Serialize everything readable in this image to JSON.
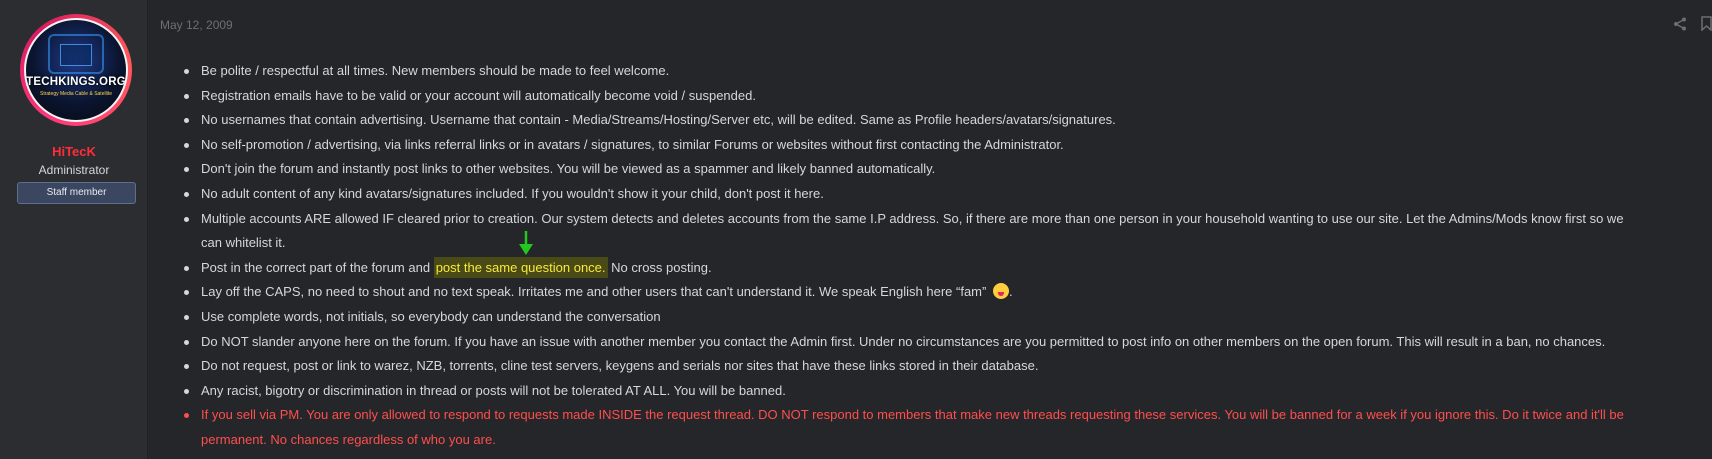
{
  "user": {
    "avatar_text": "TECHKINGS.ORG",
    "avatar_tagline": "Strategy Media Cable & Satellite",
    "name": "HiTecK",
    "title": "Administrator",
    "badge": "Staff member"
  },
  "post": {
    "date": "May 12, 2009",
    "rules": [
      {
        "text": "Be polite / respectful at all times. New members should be made to feel welcome."
      },
      {
        "text": "Registration emails have to be valid or your account will automatically become void / suspended."
      },
      {
        "text": "No usernames that contain advertising. Username that contain - Media/Streams/Hosting/Server etc, will be edited. Same as Profile headers/avatars/signatures."
      },
      {
        "text": "No self-promotion / advertising, via links referral links or in avatars / signatures, to similar Forums or websites without first contacting the Administrator."
      },
      {
        "text": "Don't join the forum and instantly post links to other websites. You will be viewed as a spammer and likely banned automatically."
      },
      {
        "text": "No adult content of any kind avatars/signatures included. If you wouldn't show it your child, don't post it here."
      },
      {
        "text": "Multiple accounts ARE allowed IF cleared prior to creation. Our system detects and deletes accounts from the same I.P address. So, if there are more than one person in your household wanting to use our site. Let the Admins/Mods know first so we",
        "cont": "can whitelist it."
      },
      {
        "before": "Post in the correct part of the forum and ",
        "highlight": "post the same question once.",
        "after": " No cross posting."
      },
      {
        "text": "Lay off the CAPS, no need to shout and no text speak. Irritates me and other users that can't understand it. We speak English here “fam”",
        "emoji_after": "."
      },
      {
        "text": "Use complete words, not initials, so everybody can understand the conversation"
      },
      {
        "text": "Do NOT slander anyone here on the forum. If you have an issue with another member you contact the Admin first. Under no circumstances are you permitted to post info on other members on the open forum. This will result in a ban, no chances."
      },
      {
        "text": "Do not request, post or link to warez, NZB, torrents, cline test servers, keygens and serials nor sites that have these links stored in their database."
      },
      {
        "text": "Any racist, bigotry or discrimination in thread or posts will not be tolerated AT ALL. You will be banned."
      },
      {
        "text": "If you sell via PM. You are only allowed to respond to requests made INSIDE the request thread. DO NOT respond to members that make new threads requesting these services. You will be banned for a week if you ignore this. Do it twice and it'll be",
        "cont": "permanent. No chances regardless of who you are."
      }
    ]
  },
  "colors": {
    "background": "#252629",
    "username": "#ff2d3a",
    "highlight_bg": "#4a4a17",
    "highlight_text": "#f7ea3a",
    "warning_text": "#ff4e4e",
    "arrow": "#22c81e"
  },
  "icons": [
    "share-icon",
    "bookmark-icon",
    "arrow-down-icon",
    "emoji-tongue-icon"
  ]
}
